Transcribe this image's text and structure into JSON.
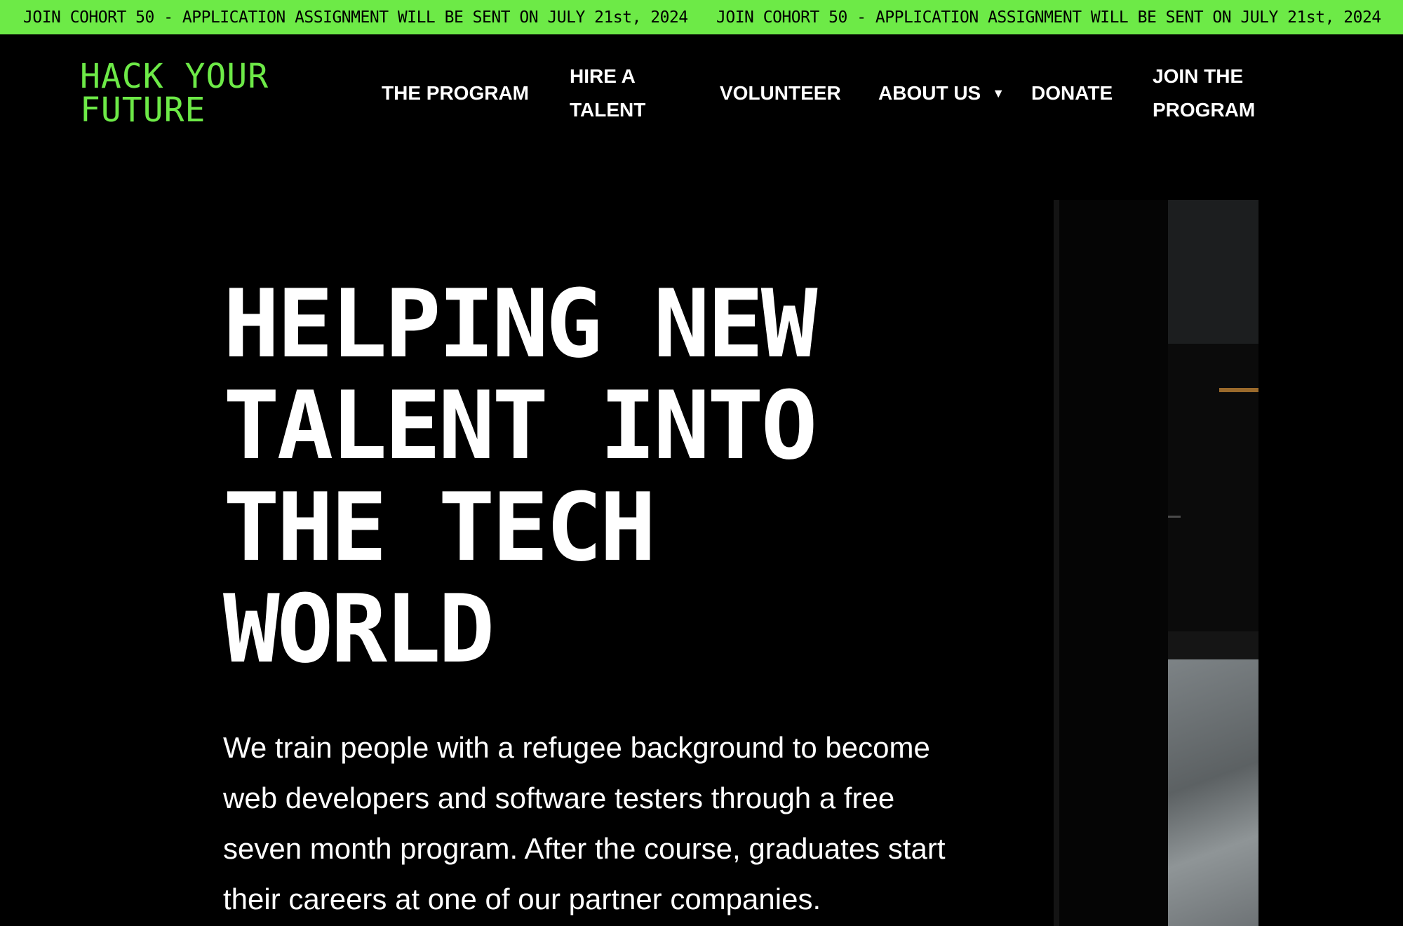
{
  "ticker": {
    "items": [
      "JOIN COHORT 50 - APPLICATION ASSIGNMENT WILL BE SENT ON JULY 21st, 2024",
      "JOIN COHORT 50 - APPLICATION ASSIGNMENT WILL BE SENT ON JULY 21st, 2024"
    ]
  },
  "header": {
    "logo": {
      "line1": "HACK YOUR",
      "line2": "FUTURE"
    },
    "nav": {
      "program": "THE PROGRAM",
      "hire_line1": "HIRE A",
      "hire_line2": "TALENT",
      "volunteer": "VOLUNTEER",
      "about": "ABOUT US",
      "about_caret": "▼",
      "donate": "DONATE",
      "join_line1": "JOIN THE",
      "join_line2": "PROGRAM"
    }
  },
  "hero": {
    "title_lines": [
      "HELPING NEW",
      "TALENT INTO",
      "THE TECH",
      "WORLD"
    ],
    "description": "We train people with a refugee background to become web developers and software testers through a free seven month program. After the course, graduates start their careers at one of our partner companies."
  },
  "colors": {
    "accent": "#6dea47",
    "background": "#000000",
    "text": "#ffffff"
  }
}
